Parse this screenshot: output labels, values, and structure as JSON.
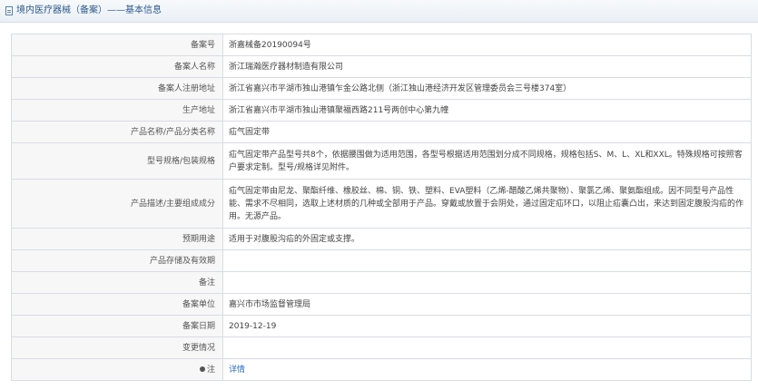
{
  "header": {
    "title": "境内医疗器械（备案）——基本信息"
  },
  "rows": [
    {
      "label": "备案号",
      "value": "浙嘉械备20190094号"
    },
    {
      "label": "备案人名称",
      "value": "浙江瑞瀚医疗器材制造有限公司"
    },
    {
      "label": "备案人注册地址",
      "value": "浙江省嘉兴市平湖市独山港镇乍金公路北侧（浙江独山港经济开发区管理委员会三号楼374室）"
    },
    {
      "label": "生产地址",
      "value": "浙江省嘉兴市平湖市独山港镇聚福西路211号两创中心第九幢"
    },
    {
      "label": "产品名称/产品分类名称",
      "value": "疝气固定带"
    },
    {
      "label": "型号规格/包装规格",
      "value": "疝气固定带产品型号共8个，依据腰围做为适用范围，各型号根据适用范围划分成不同规格，规格包括S、M、L、XL和XXL。特殊规格可按照客户要求定制。型号/规格详见附件。"
    },
    {
      "label": "产品描述/主要组成成分",
      "value": "疝气固定带由尼龙、聚酯纤维、橡胶丝、棉、铜、铁、塑料、EVA塑料（乙烯-醋酸乙烯共聚物）、聚氯乙烯、聚氨酯组成。因不同型号产品性能、需求不尽相同，选取上述材质的几种或全部用于产品。穿戴或放置于会阴处，通过固定疝环口，以阻止疝囊凸出，来达到固定腹股沟疝的作用。无源产品。"
    },
    {
      "label": "预期用途",
      "value": "适用于对腹股沟疝的外固定或支撑。"
    },
    {
      "label": "产品存储及有效期",
      "value": ""
    },
    {
      "label": "备注",
      "value": ""
    },
    {
      "label": "备案单位",
      "value": "嘉兴市市场监督管理局"
    },
    {
      "label": "备案日期",
      "value": "2019-12-19"
    },
    {
      "label": "变更情况",
      "value": ""
    },
    {
      "label": "注",
      "value": "详情"
    }
  ]
}
